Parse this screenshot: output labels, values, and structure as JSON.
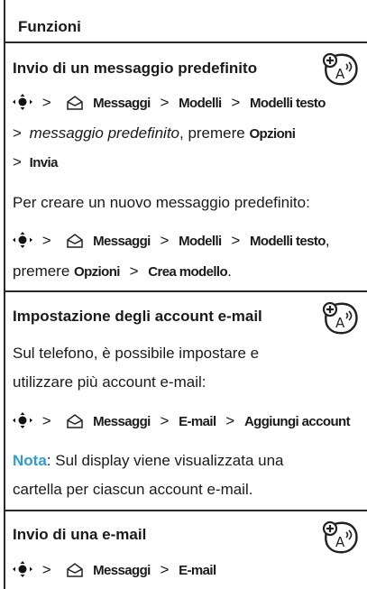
{
  "header": {
    "title": "Funzioni"
  },
  "sections": [
    {
      "title": "Invio di un messaggio predefinito",
      "icon": "network-feature-badge-icon",
      "nav1": {
        "messaggi": "Messaggi",
        "modelli": "Modelli",
        "modelli_testo": "Modelli testo"
      },
      "line2": {
        "italic": "messaggio predefinito",
        "text": ", premere ",
        "opzioni": "Opzioni"
      },
      "line3": {
        "invia": "Invia"
      },
      "para": "Per creare un nuovo messaggio predefinito:",
      "nav2": {
        "messaggi": "Messaggi",
        "modelli": "Modelli",
        "modelli_testo": "Modelli testo",
        "comma": ","
      },
      "line6": {
        "text": "premere ",
        "opzioni": "Opzioni",
        "crea": "Crea modello",
        "period": "."
      }
    },
    {
      "title": "Impostazione degli account e-mail",
      "icon": "network-feature-badge-icon",
      "para1": "Sul telefono, è possibile impostare e",
      "para2": "utilizzare più account e-mail:",
      "nav": {
        "messaggi": "Messaggi",
        "email": "E-mail",
        "aggiungi": "Aggiungi account"
      },
      "note_label": "Nota",
      "note_text1": ": Sul display viene visualizzata una",
      "note_text2": "cartella per ciascun account e-mail."
    },
    {
      "title": "Invio di una e-mail",
      "icon": "network-feature-badge-icon",
      "nav": {
        "messaggi": "Messaggi",
        "email": "E-mail"
      }
    }
  ],
  "symbols": {
    "gt": ">"
  }
}
